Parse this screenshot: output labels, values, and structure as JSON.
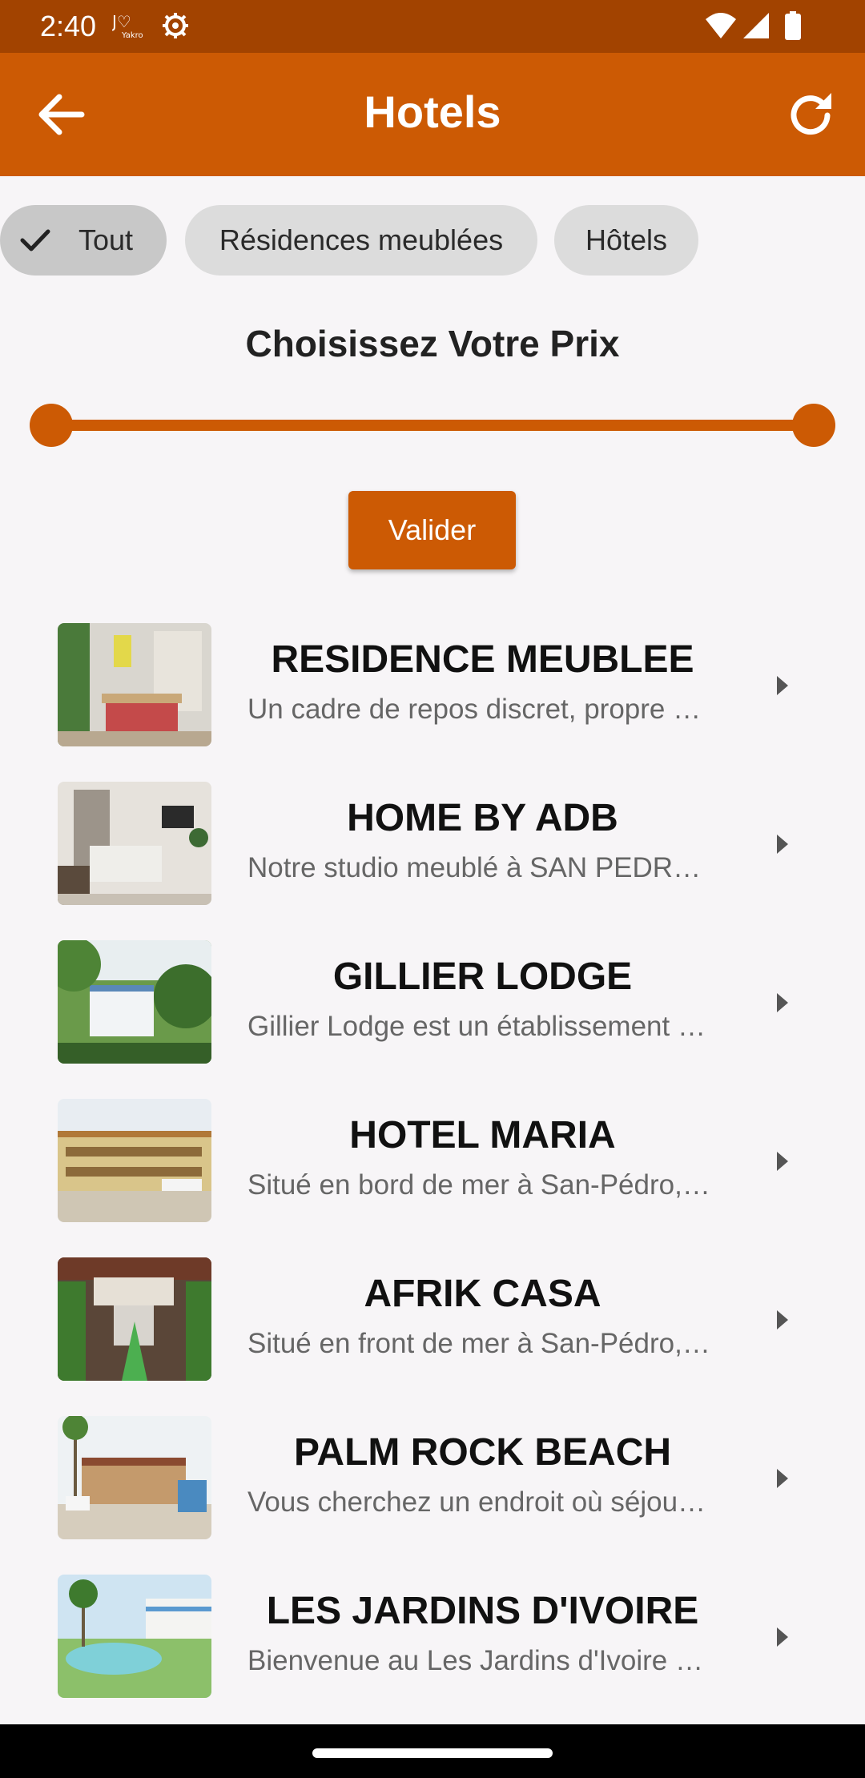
{
  "status_bar": {
    "time": "2:40",
    "icons": [
      "yakro-logo-icon",
      "settings-icon",
      "wifi-icon",
      "signal-icon",
      "battery-icon"
    ]
  },
  "app_bar": {
    "title": "Hotels",
    "back_icon": "arrow-back-icon",
    "refresh_icon": "refresh-icon",
    "color": "#cc5a04"
  },
  "filters": {
    "chips": [
      {
        "label": "Tout",
        "selected": true
      },
      {
        "label": "Résidences meublées",
        "selected": false
      },
      {
        "label": "Hôtels",
        "selected": false
      }
    ]
  },
  "price_filter": {
    "heading": "Choisissez Votre Prix",
    "range_min_fraction": 0,
    "range_max_fraction": 1,
    "validate_label": "Valider"
  },
  "hotels": [
    {
      "name": "RESIDENCE MEUBLEE",
      "description": "Un cadre de repos discret, propre et agréable"
    },
    {
      "name": "HOME BY ADB",
      "description": "Notre studio meublé à SAN PEDRO est idéal"
    },
    {
      "name": "GILLIER LODGE",
      "description": "Gillier Lodge est un établissement situé à San-Pédro"
    },
    {
      "name": "HOTEL MARIA",
      "description": "Situé en bord de mer à San-Pédro, l'hôtel Maria"
    },
    {
      "name": "AFRIK CASA",
      "description": "Situé en front de mer à San-Pédro, Afrik Casa"
    },
    {
      "name": "PALM ROCK BEACH",
      "description": "Vous cherchez un endroit où séjourner à San-Pédro"
    },
    {
      "name": "LES JARDINS D'IVOIRE",
      "description": "Bienvenue au Les Jardins d'Ivoire à San-Pédro"
    }
  ],
  "colors": {
    "accent": "#cc5a04",
    "status_bar": "#a24300",
    "background": "#f7f5f7"
  }
}
